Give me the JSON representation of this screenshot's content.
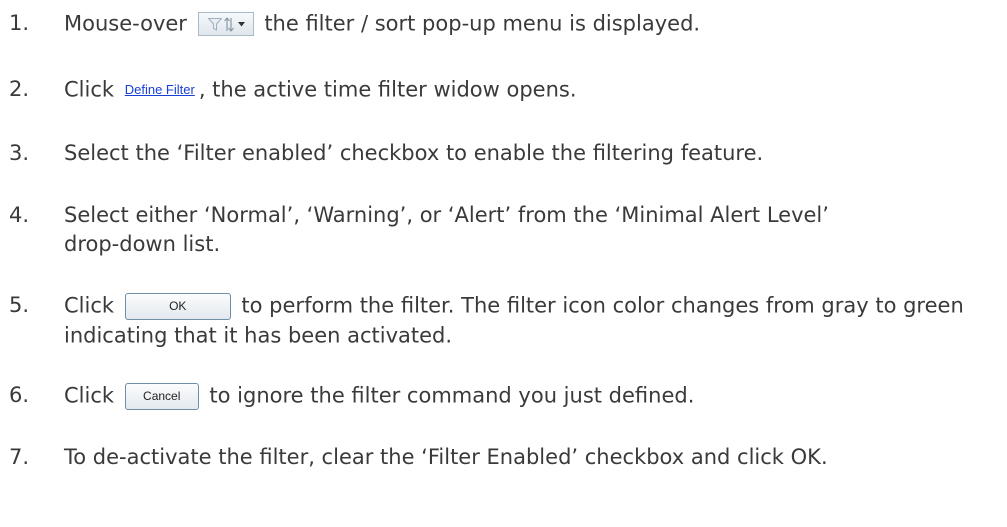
{
  "steps": [
    {
      "num": "1.",
      "before": "Mouse-over",
      "after": "the filter / sort pop-up menu is displayed."
    },
    {
      "num": "2.",
      "before": "Click",
      "link": "Define Filter",
      "after": ", the active time filter widow opens."
    },
    {
      "num": "3.",
      "text": "Select the ‘Filter enabled’ checkbox to enable the filtering feature."
    },
    {
      "num": "4.",
      "text": "Select either ‘Normal’, ‘Warning’, or ‘Alert’ from the ‘Minimal Alert Level’ drop-down list."
    },
    {
      "num": "5.",
      "before": "Click",
      "button": "OK",
      "after": "to perform the filter. The filter icon color changes from gray to green indicating that it has been activated."
    },
    {
      "num": "6.",
      "before": "Click",
      "button": "Cancel",
      "after": "to ignore the filter command you just defined."
    },
    {
      "num": "7.",
      "text": "To de-activate the filter, clear the ‘Filter Enabled’ checkbox and click OK."
    }
  ],
  "icons": {
    "filter_sort": "filter-sort-dropdown-icon"
  },
  "colors": {
    "text": "#3a3a3a",
    "link": "#1a3fd6"
  }
}
